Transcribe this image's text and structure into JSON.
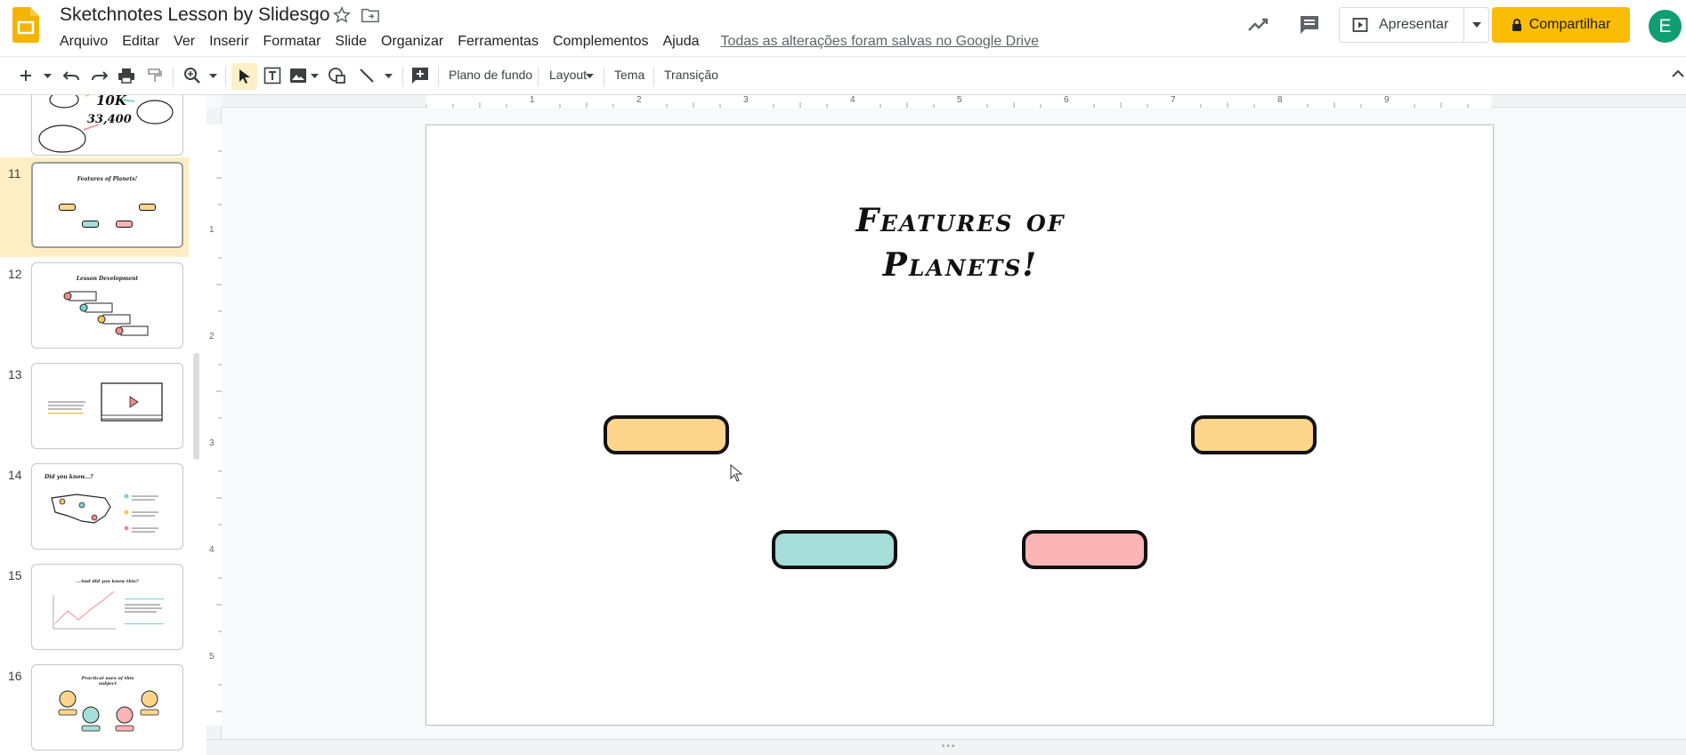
{
  "header": {
    "title": "Sketchnotes Lesson by Slidesgo",
    "menu": [
      "Arquivo",
      "Editar",
      "Ver",
      "Inserir",
      "Formatar",
      "Slide",
      "Organizar",
      "Ferramentas",
      "Complementos",
      "Ajuda"
    ],
    "save_status": "Todas as alterações foram salvas no Google Drive",
    "present_label": "Apresentar",
    "share_label": "Compartilhar",
    "avatar_letter": "E"
  },
  "toolbar": {
    "background_label": "Plano de fundo",
    "layout_label": "Layout",
    "theme_label": "Tema",
    "transition_label": "Transição"
  },
  "filmstrip": {
    "slides": [
      {
        "number": "11",
        "title": "Features of Planets!"
      },
      {
        "number": "12",
        "title": "Lesson Development"
      },
      {
        "number": "13",
        "title": ""
      },
      {
        "number": "14",
        "title": "Did you know...?"
      },
      {
        "number": "15",
        "title": "...And did you know this?"
      },
      {
        "number": "16",
        "title": "Practical uses of this subject"
      }
    ],
    "prev_slide_numbers": [
      "10K",
      "33,400"
    ]
  },
  "rulers": {
    "horizontal": [
      "1",
      "2",
      "3",
      "4",
      "5",
      "6",
      "7",
      "8",
      "9"
    ],
    "vertical": [
      "1",
      "2",
      "3",
      "4",
      "5"
    ]
  },
  "slide": {
    "title_line1": "Features of",
    "title_line2": "Planets!"
  },
  "colors": {
    "accent_yellow": "#fbbc04",
    "active_slide_bg": "#fdefc3",
    "pill_orange": "#fdd58b",
    "pill_teal": "#a6ddd9",
    "pill_pink": "#fdb4b4"
  }
}
